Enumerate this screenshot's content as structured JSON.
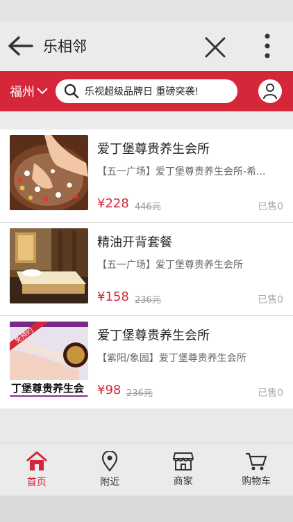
{
  "header": {
    "title": "乐相邻"
  },
  "search": {
    "city": "福州",
    "placeholder": "乐视超级品牌日 重磅突袭!"
  },
  "items": [
    {
      "title": "爱丁堡尊贵养生会所",
      "subtitle": "【五一广场】爱丁堡尊贵养生会所-希...",
      "price": "¥228",
      "original_price": "446元",
      "sold": "已售0"
    },
    {
      "title": "精油开背套餐",
      "subtitle": "【五一广场】爱丁堡尊贵养生会所",
      "price": "¥158",
      "original_price": "236元",
      "sold": "已售0"
    },
    {
      "title": "爱丁堡尊贵养生会所",
      "subtitle": "【紫阳/象园】爱丁堡尊贵养生会所",
      "price": "¥98",
      "original_price": "236元",
      "sold": "已售0",
      "badge": "免预约",
      "banner_text": "丁堡尊贵养生会"
    }
  ],
  "tabs": [
    {
      "label": "首页",
      "icon": "home-icon"
    },
    {
      "label": "附近",
      "icon": "location-pin-icon"
    },
    {
      "label": "商家",
      "icon": "store-icon"
    },
    {
      "label": "购物车",
      "icon": "cart-icon"
    }
  ],
  "colors": {
    "accent": "#d6263a"
  }
}
